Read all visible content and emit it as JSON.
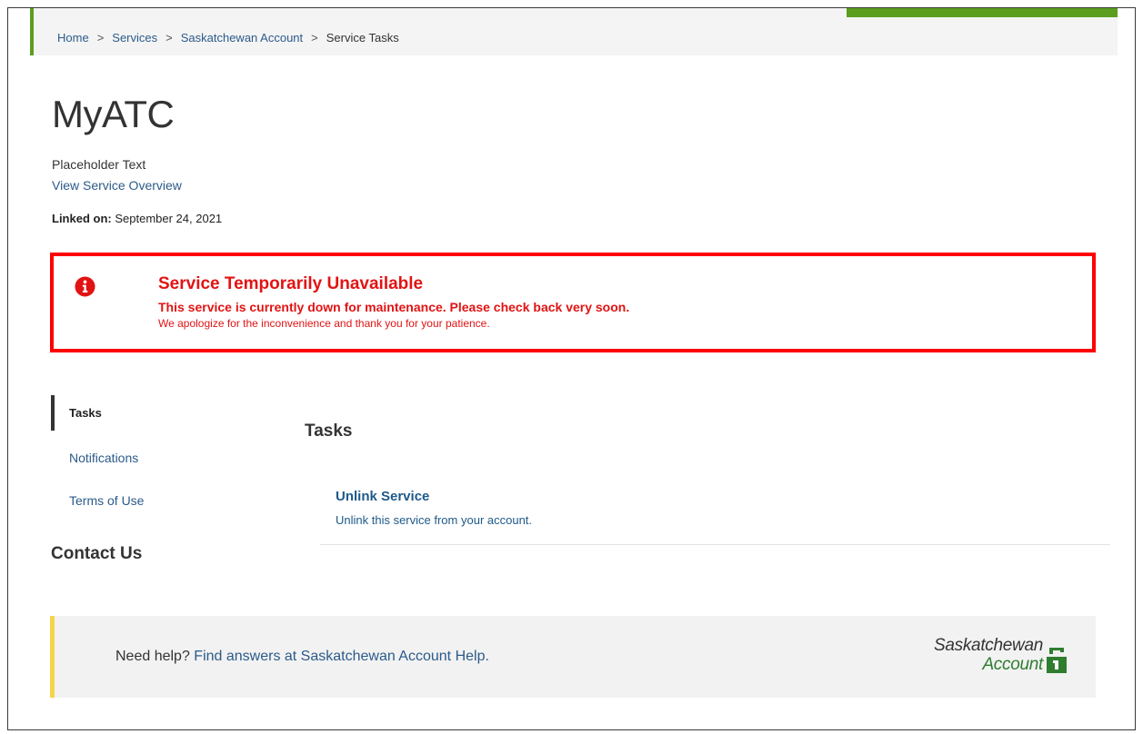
{
  "breadcrumb": {
    "items": [
      "Home",
      "Services",
      "Saskatchewan Account"
    ],
    "current": "Service Tasks",
    "separator": ">"
  },
  "page": {
    "title": "MyATC",
    "placeholder_text": "Placeholder Text",
    "overview_link": "View Service Overview",
    "linked_label": "Linked on:",
    "linked_date": "September 24, 2021"
  },
  "alert": {
    "icon": "info-circle-icon",
    "title": "Service Temporarily Unavailable",
    "message": "This service is currently down for maintenance. Please check back very soon.",
    "subtext": "We apologize for the inconvenience and thank you for your patience.",
    "color": "#e21313"
  },
  "sidenav": {
    "items": [
      "Tasks",
      "Notifications",
      "Terms of Use"
    ],
    "active": "Tasks"
  },
  "contact_heading": "Contact Us",
  "tasks": {
    "heading": "Tasks",
    "items": [
      {
        "title": "Unlink Service",
        "description": "Unlink this service from your account."
      }
    ]
  },
  "help": {
    "prefix": "Need help?",
    "link": "Find answers at Saskatchewan Account Help."
  },
  "logo": {
    "line1": "Saskatchewan",
    "line2": "Account"
  },
  "colors": {
    "accent_green": "#5c9e1f",
    "link_blue": "#2b5b8a",
    "help_accent": "#f5d44c"
  }
}
